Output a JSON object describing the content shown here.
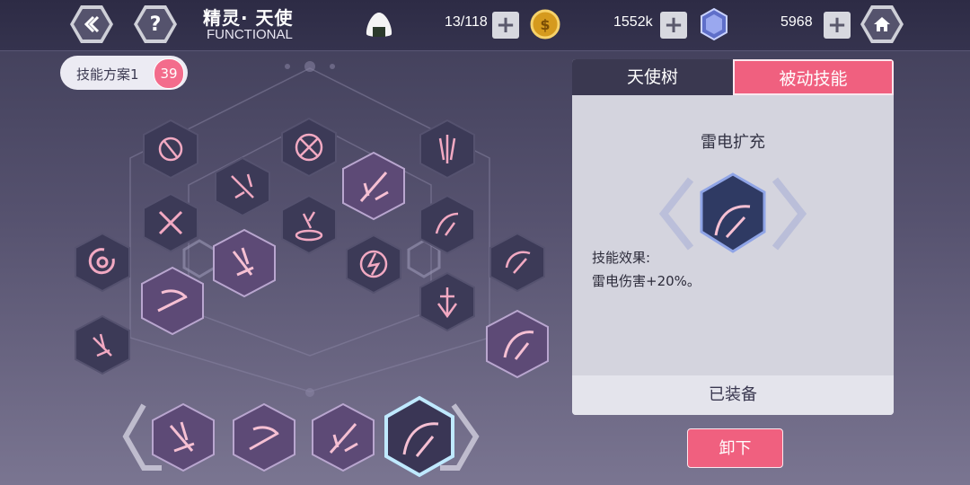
{
  "header": {
    "title_cn": "精灵· 天使",
    "title_en": "FUNCTIONAL",
    "stamina": "13/118",
    "gold": "1552k",
    "gems": "5968",
    "gold_coin_text": "$"
  },
  "plan": {
    "label": "技能方案1",
    "count": "39"
  },
  "panel": {
    "tabs": [
      {
        "label": "天使树"
      },
      {
        "label": "被动技能"
      }
    ],
    "skill_name": "雷电扩充",
    "effect_title": "技能效果:",
    "effect_desc": "雷电伤害+20%。",
    "equipped_label": "已装备"
  },
  "unequip_label": "卸下",
  "colors": {
    "accent": "#f0607f",
    "panel": "#d4d4de",
    "dark": "#3a3850"
  },
  "icons": {
    "back": "chevron-left-icon",
    "help": "question-icon",
    "home": "home-icon",
    "stamina": "rice-ball-icon",
    "gold": "coin-icon",
    "gem": "crystal-icon"
  }
}
